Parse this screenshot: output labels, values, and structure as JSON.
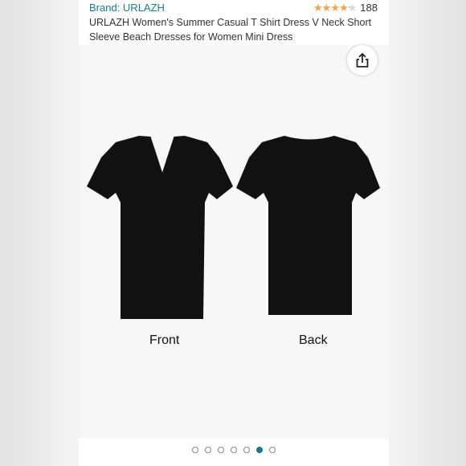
{
  "listing": {
    "brand_label": "Brand: URLAZH",
    "rating_value": 4.3,
    "rating_count": "188",
    "title": "URLAZH Women's Summer Casual T Shirt Dress V Neck Short Sleeve Beach Dresses for Women Mini Dress"
  },
  "gallery": {
    "captions": {
      "front": "Front",
      "back": "Back"
    },
    "total_images": 7,
    "active_index": 5
  },
  "icons": {
    "share": "share-icon"
  },
  "colors": {
    "link": "#1b7a8c",
    "star": "#f3a847",
    "active_dot": "#0f7d86",
    "garment": "#111111"
  }
}
